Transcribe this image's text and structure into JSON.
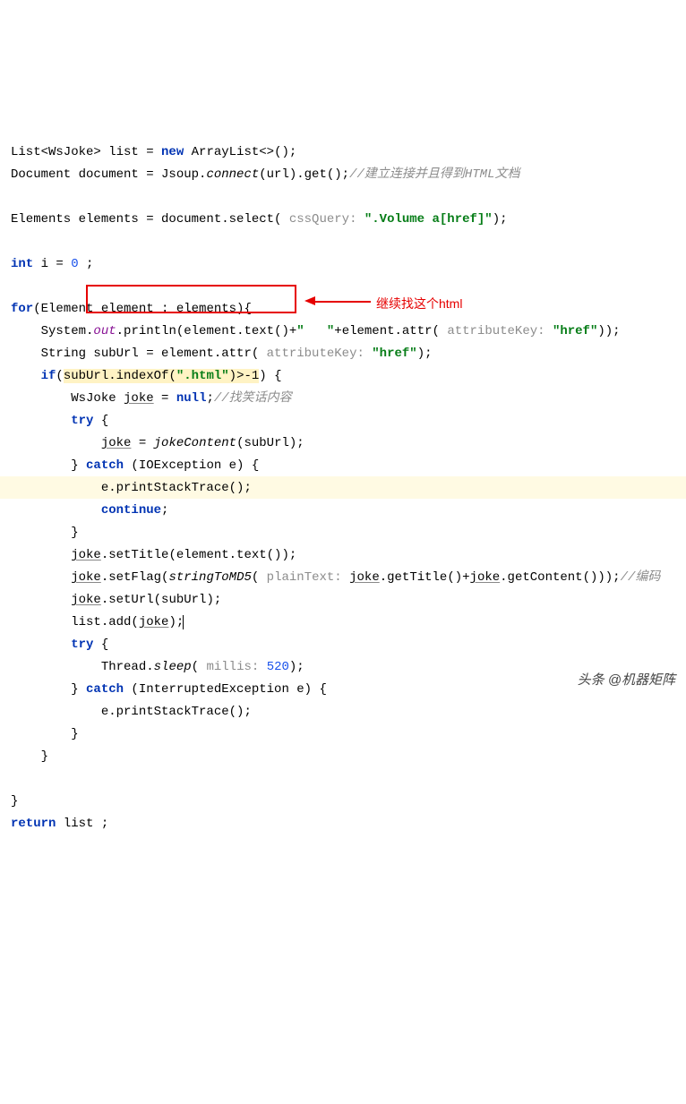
{
  "code": {
    "L1_a": "List<WsJoke> list = ",
    "L1_new": "new",
    "L1_b": " ArrayList<>();",
    "L2_a": "Document document = Jsoup.",
    "L2_fn": "connect",
    "L2_b": "(url).get();",
    "L2_cmt": "//建立连接并且得到HTML文档",
    "L4_a": "Elements elements = document.select(",
    "L4_p": " cssQuery: ",
    "L4_s": "\".Volume a[href]\"",
    "L4_b": ");",
    "L6_kw": "int",
    "L6_a": " i = ",
    "L6_n": "0",
    "L6_b": " ;",
    "L8_kw": "for",
    "L8_a": "(Element element : elements){",
    "L9_a": "    System.",
    "L9_out": "out",
    "L9_b": ".println(element.text()+",
    "L9_s1": "\"   \"",
    "L9_c": "+element.attr(",
    "L9_p": " attributeKey: ",
    "L9_s2": "\"href\"",
    "L9_d": "));",
    "L10_a": "    String subUrl = element.attr(",
    "L10_p": " attributeKey: ",
    "L10_s": "\"href\"",
    "L10_b": ");",
    "L11_kw": "if",
    "L11_a": "(",
    "L11_sub": "subUrl.indexOf(",
    "L11_s": "\".html\"",
    "L11_sub2": ")>-1",
    "L11_b": ") {",
    "L12_a": "        WsJoke ",
    "L12_u": "joke",
    "L12_b": " = ",
    "L12_kw": "null",
    "L12_c": ";",
    "L12_cmt": "//找笑话内容",
    "L13_kw": "try",
    "L13_a": " {",
    "L14_u": "joke",
    "L14_a": " = ",
    "L14_fn": "jokeContent",
    "L14_b": "(subUrl);",
    "L15_a": "        } ",
    "L15_kw": "catch",
    "L15_b": " (IOException e) {",
    "L16_a": "            e.printStackTrace();",
    "L17_kw": "continue",
    "L17_a": ";",
    "L18_a": "        }",
    "L19_a": "        ",
    "L19_u": "joke",
    "L19_b": ".setTitle(element.text());",
    "L20_a": "        ",
    "L20_u": "joke",
    "L20_b": ".setFlag(",
    "L20_fn": "stringToMD5",
    "L20_c": "(",
    "L20_p": " plainText: ",
    "L20_u2": "joke",
    "L20_d": ".getTitle()+",
    "L20_u3": "joke",
    "L20_e": ".getContent()));",
    "L20_cmt": "//编码",
    "L21_a": "        ",
    "L21_u": "joke",
    "L21_b": ".setUrl(subUrl);",
    "L22_a": "        list.add(",
    "L22_u": "joke",
    "L22_b": ");",
    "L23_kw": "try",
    "L23_a": " {",
    "L24_a": "            Thread.",
    "L24_fn": "sleep",
    "L24_b": "(",
    "L24_p": " millis: ",
    "L24_n": "520",
    "L24_c": ");",
    "L25_a": "        } ",
    "L25_kw": "catch",
    "L25_b": " (InterruptedException e) {",
    "L26_a": "            e.printStackTrace();",
    "L27_a": "        }",
    "L28_a": "    }",
    "L30_a": "}",
    "L31_kw": "return",
    "L31_a": " list ;"
  },
  "annotation": {
    "text": "继续找这个html"
  },
  "watermark": "头条 @机器矩阵"
}
